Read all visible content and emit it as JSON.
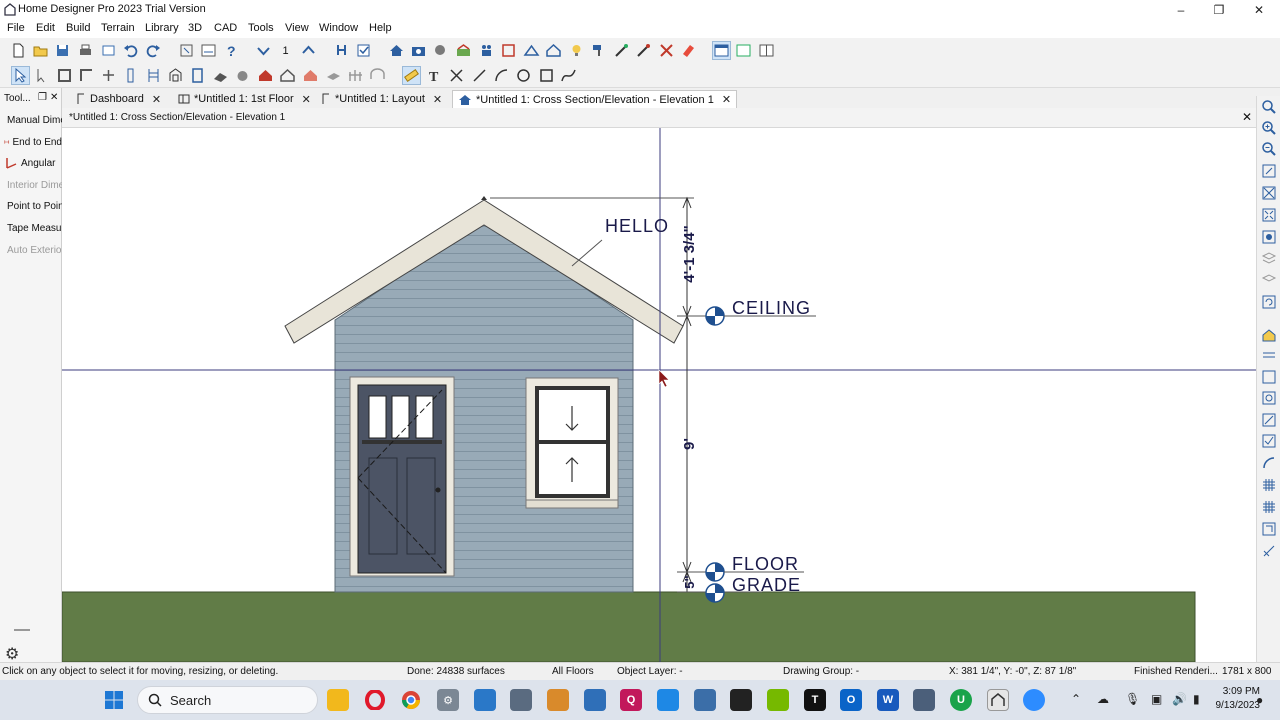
{
  "window": {
    "title": "Home Designer Pro 2023 Trial Version"
  },
  "menu": [
    "File",
    "Edit",
    "Build",
    "Terrain",
    "Library",
    "3D",
    "CAD",
    "Tools",
    "View",
    "Window",
    "Help"
  ],
  "toolbar": {
    "floor_number": "1"
  },
  "tabs": [
    {
      "label": "Dashboard",
      "icon": "dashboard-icon"
    },
    {
      "label": "*Untitled 1: 1st Floor",
      "icon": "floor-plan-icon"
    },
    {
      "label": "*Untitled 1: Layout",
      "icon": "layout-icon"
    },
    {
      "label": "*Untitled 1: Cross Section/Elevation - Elevation 1",
      "icon": "elevation-icon",
      "active": true
    }
  ],
  "tool_panel": {
    "title": "Tool...",
    "items": [
      {
        "label": "Manual Dimension",
        "icon": "ruler-icon",
        "enabled": true
      },
      {
        "label": "End to End",
        "icon": "end-to-end-icon",
        "enabled": true
      },
      {
        "label": "Angular",
        "icon": "angular-icon",
        "enabled": true
      },
      {
        "label": "Interior Dimension",
        "icon": "interior-dimension-icon",
        "enabled": false
      },
      {
        "label": "Point to Point",
        "icon": "point-to-point-icon",
        "enabled": true
      },
      {
        "label": "Tape Measure",
        "icon": "tape-measure-icon",
        "enabled": true
      },
      {
        "label": "Auto Exterior",
        "icon": "auto-exterior-icon",
        "enabled": false
      }
    ]
  },
  "document": {
    "title": "*Untitled 1: Cross Section/Elevation - Elevation 1"
  },
  "drawing": {
    "annotation": "HELLO",
    "dim_top": "4'-1 3/4\"",
    "dim_middle": "9'",
    "dim_bottom": "5\"",
    "markers": [
      {
        "label": "CEILING"
      },
      {
        "label": "FLOOR"
      },
      {
        "label": "GRADE"
      }
    ],
    "colors": {
      "siding": "#98aab7",
      "trim": "#e8e4d8",
      "door": "#4c5465",
      "ground": "#617c47",
      "line": "#3b3b7e",
      "marker": "#1f4f8f"
    }
  },
  "status": {
    "hint": "Click on any object to select it for moving, resizing, or deleting.",
    "done": "Done: 24838 surfaces",
    "floors": "All Floors",
    "object_layer": "Object Layer: -",
    "drawing_group": "Drawing Group: -",
    "coords": "X: 381 1/4\", Y: -0\", Z: 87 1/8\"",
    "render": "Finished Renderi...",
    "size": "1781 x 800"
  },
  "taskbar": {
    "search_placeholder": "Search",
    "time": "3:09 PM",
    "date": "9/13/2023"
  }
}
